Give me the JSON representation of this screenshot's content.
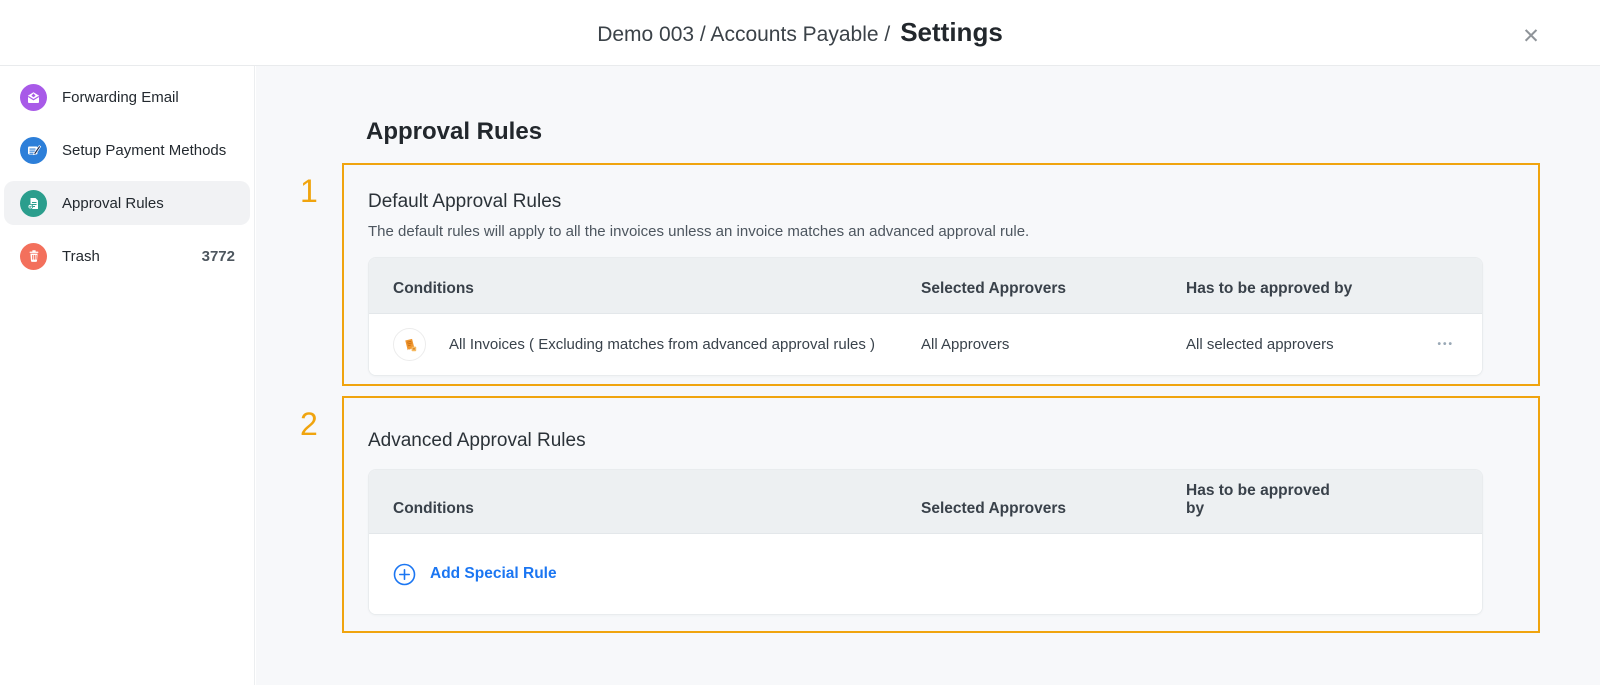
{
  "header": {
    "breadcrumb": "Demo 003 / Accounts Payable /",
    "title": "Settings",
    "close_glyph": "✕"
  },
  "sidebar": {
    "items": [
      {
        "label": "Forwarding Email",
        "icon": "mail-icon"
      },
      {
        "label": "Setup Payment Methods",
        "icon": "payment-methods-icon"
      },
      {
        "label": "Approval Rules",
        "icon": "approval-rules-icon",
        "active": true
      },
      {
        "label": "Trash",
        "icon": "trash-icon",
        "badge": "3772"
      }
    ]
  },
  "main": {
    "title": "Approval Rules",
    "sections": [
      {
        "number": "1",
        "title": "Default Approval Rules",
        "description": "The default rules will apply to all the invoices unless an invoice matches an advanced approval rule.",
        "table": {
          "headers": [
            "Conditions",
            "Selected Approvers",
            "Has to be approved by"
          ],
          "rows": [
            {
              "condition": "All Invoices ( Excluding matches from advanced approval rules )",
              "selected_approvers": "All Approvers",
              "approved_by": "All selected approvers",
              "more_glyph": "•••"
            }
          ]
        }
      },
      {
        "number": "2",
        "title": "Advanced Approval Rules",
        "table": {
          "headers": [
            "Conditions",
            "Selected Approvers",
            "Has to be approved by"
          ],
          "rows": []
        },
        "add_rule_label": "Add Special Rule"
      }
    ]
  },
  "colors": {
    "accent-orange": "#f0a40e",
    "link-blue": "#1b76f2",
    "icon-purple": "#a85ae8",
    "icon-blue": "#2d7fd9",
    "icon-teal": "#2b9e8d",
    "icon-salmon": "#f3705c",
    "invoice-orange": "#f0962e"
  }
}
